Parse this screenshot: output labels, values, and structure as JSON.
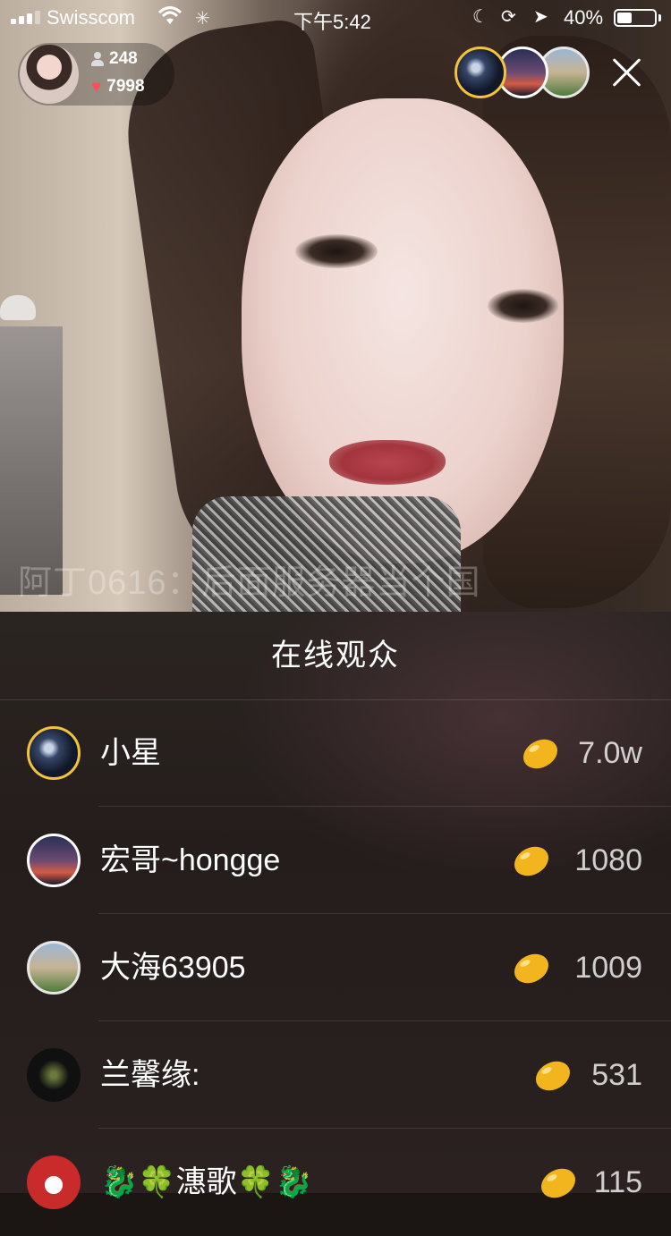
{
  "status_bar": {
    "carrier": "Swisscom",
    "time": "下午5:42",
    "battery_percent": "40%",
    "battery_level": 0.4
  },
  "host": {
    "viewer_count": "248",
    "like_count": "7998"
  },
  "top_viewers": [
    "小星",
    "宏哥~hongge",
    "大海63905"
  ],
  "background_comment": "阿丁0616：后面服务器当个国",
  "audience_panel": {
    "title": "在线观众",
    "viewers": [
      {
        "name": "小星",
        "amount": "7.0w"
      },
      {
        "name": "宏哥~hongge",
        "amount": "1080"
      },
      {
        "name": "大海63905",
        "amount": "1009"
      },
      {
        "name": "兰馨缘:",
        "amount": "531"
      },
      {
        "name": "🐉🍀潓歌🍀🐉",
        "amount": "115"
      }
    ]
  },
  "colors": {
    "top_rank_border": "#f2c33b",
    "bean": "#f2b51e",
    "heart": "#ff4d5a"
  },
  "icons": [
    "signal-icon",
    "wifi-icon",
    "loading-icon",
    "moon-icon",
    "orientation-lock-icon",
    "location-arrow-icon",
    "battery-icon",
    "person-icon",
    "heart-icon",
    "close-icon",
    "bean-icon"
  ]
}
